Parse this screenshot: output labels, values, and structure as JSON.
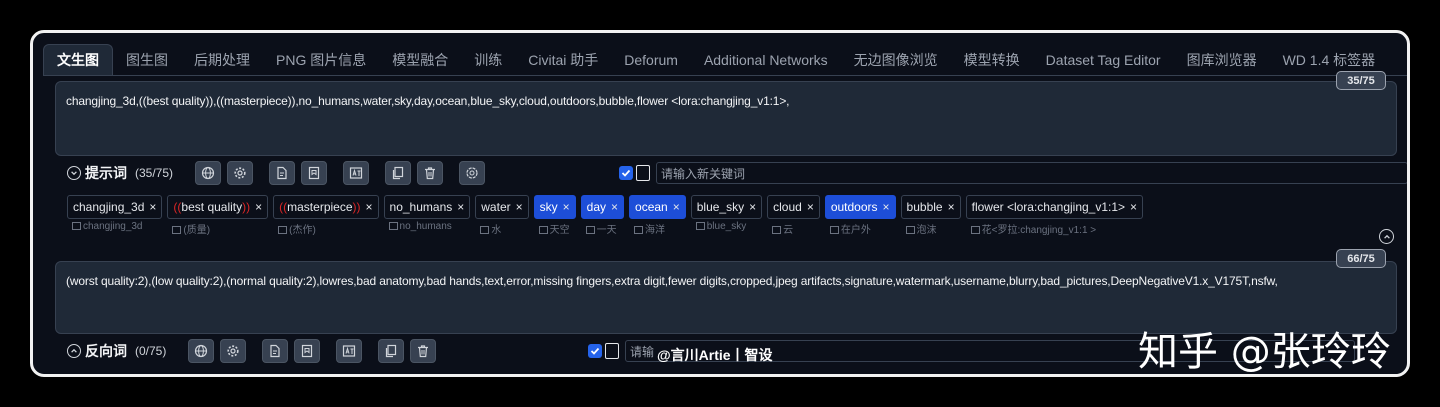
{
  "tabs": [
    {
      "label": "文生图",
      "active": true
    },
    {
      "label": "图生图"
    },
    {
      "label": "后期处理"
    },
    {
      "label": "PNG 图片信息"
    },
    {
      "label": "模型融合"
    },
    {
      "label": "训练"
    },
    {
      "label": "Civitai 助手"
    },
    {
      "label": "Deforum"
    },
    {
      "label": "Additional Networks"
    },
    {
      "label": "无边图像浏览"
    },
    {
      "label": "模型转换"
    },
    {
      "label": "Dataset Tag Editor"
    },
    {
      "label": "图库浏览器"
    },
    {
      "label": "WD 1.4 标签器"
    }
  ],
  "positive": {
    "counter": "35/75",
    "text": "changjing_3d,((best quality)),((masterpiece)),no_humans,water,sky,day,ocean,blue_sky,cloud,outdoors,bubble,flower <lora:changjing_v1:1>,",
    "toolbar_title": "提示词",
    "toolbar_count": "(35/75)",
    "keyword_placeholder": "请输入新关键词",
    "tags": [
      {
        "text": "changjing_3d",
        "trans": "changjing_3d",
        "hl": false
      },
      {
        "pre": "((",
        "text": "best quality",
        "post": "))",
        "trans": "(质量)",
        "hl": false
      },
      {
        "pre": "((",
        "text": "masterpiece",
        "post": "))",
        "trans": "(杰作)",
        "hl": false
      },
      {
        "text": "no_humans",
        "trans": "no_humans",
        "hl": false
      },
      {
        "text": "water",
        "trans": "水",
        "hl": false
      },
      {
        "text": "sky",
        "trans": "天空",
        "hl": true
      },
      {
        "text": "day",
        "trans": "一天",
        "hl": true
      },
      {
        "text": "ocean",
        "trans": "海洋",
        "hl": true
      },
      {
        "text": "blue_sky",
        "trans": "blue_sky",
        "hl": false
      },
      {
        "text": "cloud",
        "trans": "云",
        "hl": false
      },
      {
        "text": "outdoors",
        "trans": "在户外",
        "hl": true
      },
      {
        "text": "bubble",
        "trans": "泡沫",
        "hl": false
      },
      {
        "text": "flower <lora:changjing_v1:1>",
        "trans": "花<罗拉:changjing_v1:1 >",
        "hl": false
      }
    ]
  },
  "negative": {
    "counter": "66/75",
    "text": "(worst quality:2),(low quality:2),(normal quality:2),lowres,bad anatomy,bad hands,text,error,missing fingers,extra digit,fewer digits,cropped,jpeg artifacts,signature,watermark,username,blurry,bad_pictures,DeepNegativeV1.x_V175T,nsfw,",
    "toolbar_title": "反向词",
    "toolbar_count": "(0/75)",
    "keyword_placeholder": "请输"
  },
  "tag_close": "×",
  "watermark": "知乎 @张玲玲",
  "credit": "@言川Artie丨智设",
  "icons": {
    "toolbar_positive": [
      "globe-icon",
      "gear-icon",
      "file-edit-icon",
      "bookmark-icon",
      "translate-icon",
      "copy-icon",
      "trash-icon",
      "openai-icon"
    ],
    "toolbar_negative": [
      "globe-icon",
      "gear-icon",
      "file-edit-icon",
      "bookmark-icon",
      "translate-icon",
      "copy-icon",
      "trash-icon"
    ]
  },
  "colors": {
    "background": "#0b0f19",
    "panel": "#1f2937",
    "highlight": "#1d4ed8",
    "checkbox": "#2563eb",
    "paren": "#dc2626"
  }
}
